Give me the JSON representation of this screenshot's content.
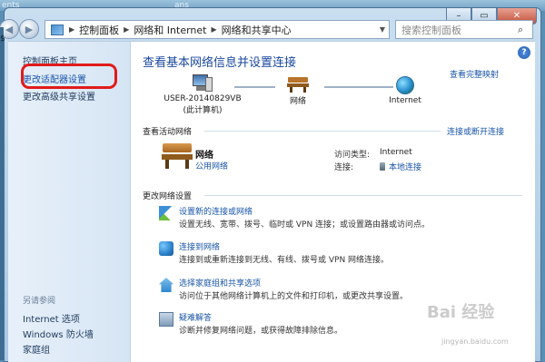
{
  "desktop": {
    "left_text": "ents ",
    "right_text": "ans"
  },
  "address": {
    "crumbs": [
      "控制面板",
      "网络和 Internet",
      "网络和共享中心"
    ],
    "search_placeholder": "搜索控制面板"
  },
  "sidebar": {
    "items": [
      "控制面板主页",
      "更改适配器设置",
      "更改高级共享设置"
    ],
    "see_also_title": "另请参阅",
    "see_also": [
      "Internet 选项",
      "Windows 防火墙",
      "家庭组"
    ]
  },
  "main": {
    "title": "查看基本网络信息并设置连接",
    "see_map": "查看完整映射",
    "map": {
      "computer": "USER-20140829VB",
      "computer_sub": "(此计算机)",
      "network": "网络",
      "internet": "Internet"
    },
    "active_head": "查看活动网络",
    "connect_or_disconnect": "连接或断开连接",
    "network_name": "网络",
    "network_type": "公用网络",
    "access_type_label": "访问类型:",
    "access_type_value": "Internet",
    "connections_label": "连接:",
    "connections_value": "本地连接",
    "change_head": "更改网络设置",
    "tasks": [
      {
        "link": "设置新的连接或网络",
        "desc": "设置无线、宽带、拨号、临时或 VPN 连接；或设置路由器或访问点。"
      },
      {
        "link": "连接到网络",
        "desc": "连接到或重新连接到无线、有线、拨号或 VPN 网络连接。"
      },
      {
        "link": "选择家庭组和共享选项",
        "desc": "访问位于其他网络计算机上的文件和打印机，或更改共享设置。"
      },
      {
        "link": "疑难解答",
        "desc": "诊断并修复网络问题，或获得故障排除信息。"
      }
    ]
  },
  "watermark": {
    "brand": "Bai 经验",
    "url": "jingyan.baidu.com"
  }
}
